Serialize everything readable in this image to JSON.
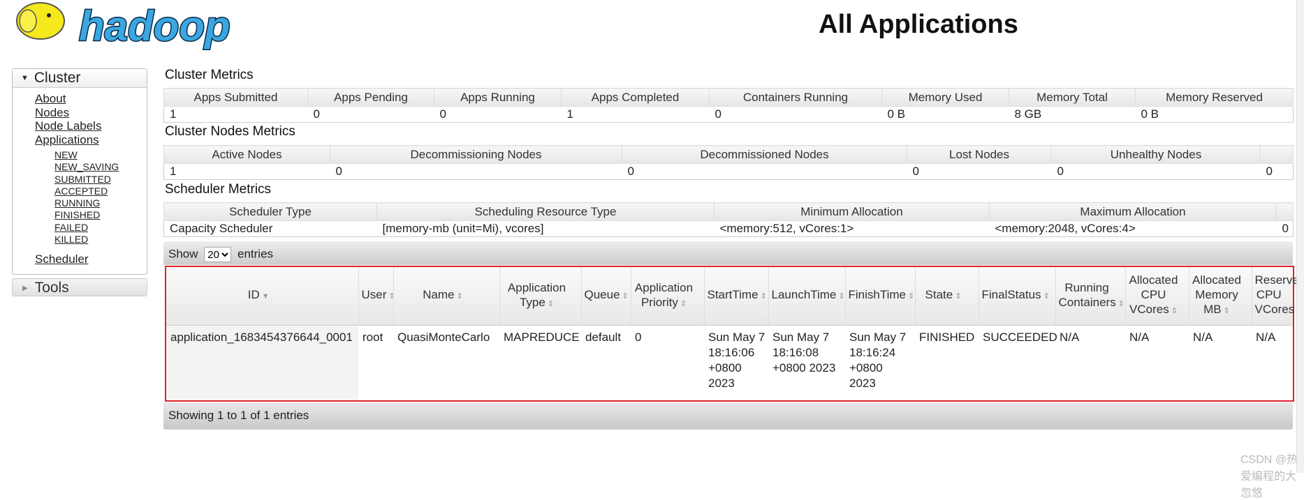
{
  "logo": {
    "text": "hadoop"
  },
  "page_title": "All Applications",
  "sidebar": {
    "cluster_label": "Cluster",
    "links": [
      "About",
      "Nodes",
      "Node Labels",
      "Applications"
    ],
    "states": [
      "NEW",
      "NEW_SAVING",
      "SUBMITTED",
      "ACCEPTED",
      "RUNNING",
      "FINISHED",
      "FAILED",
      "KILLED"
    ],
    "scheduler": "Scheduler",
    "tools_label": "Tools"
  },
  "cluster_metrics": {
    "title": "Cluster Metrics",
    "headers": [
      "Apps Submitted",
      "Apps Pending",
      "Apps Running",
      "Apps Completed",
      "Containers Running",
      "Memory Used",
      "Memory Total",
      "Memory Reserved"
    ],
    "values": [
      "1",
      "0",
      "0",
      "1",
      "0",
      "0 B",
      "8 GB",
      "0 B"
    ]
  },
  "nodes_metrics": {
    "title": "Cluster Nodes Metrics",
    "headers": [
      "Active Nodes",
      "Decommissioning Nodes",
      "Decommissioned Nodes",
      "Lost Nodes",
      "Unhealthy Nodes",
      ""
    ],
    "values": [
      "1",
      "0",
      "0",
      "0",
      "0",
      "0"
    ]
  },
  "scheduler_metrics": {
    "title": "Scheduler Metrics",
    "headers": [
      "Scheduler Type",
      "Scheduling Resource Type",
      "Minimum Allocation",
      "Maximum Allocation",
      ""
    ],
    "values": [
      "Capacity Scheduler",
      "[memory-mb (unit=Mi), vcores]",
      "<memory:512, vCores:1>",
      "<memory:2048, vCores:4>",
      "0"
    ]
  },
  "show": {
    "prefix": "Show",
    "value": "20",
    "suffix": "entries"
  },
  "apps": {
    "headers": [
      "ID",
      "User",
      "Name",
      "Application Type",
      "Queue",
      "Application Priority",
      "StartTime",
      "LaunchTime",
      "FinishTime",
      "State",
      "FinalStatus",
      "Running Containers",
      "Allocated CPU VCores",
      "Allocated Memory MB",
      "Reserved CPU VCores"
    ],
    "rows": [
      [
        "application_1683454376644_0001",
        "root",
        "QuasiMonteCarlo",
        "MAPREDUCE",
        "default",
        "0",
        "Sun May 7 18:16:06 +0800 2023",
        "Sun May 7 18:16:08 +0800 2023",
        "Sun May 7 18:16:24 +0800 2023",
        "FINISHED",
        "SUCCEEDED",
        "N/A",
        "N/A",
        "N/A",
        "N/A"
      ]
    ]
  },
  "footer": "Showing 1 to 1 of 1 entries",
  "watermark": "CSDN @热爱编程的大忽悠"
}
